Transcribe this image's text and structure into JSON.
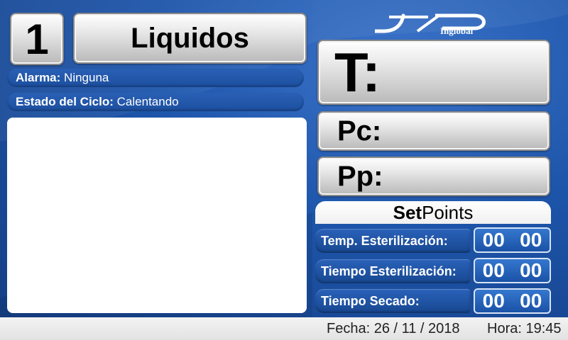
{
  "header": {
    "cycle_number": "1",
    "program_name": "Liquidos"
  },
  "status": {
    "alarm_label": "Alarma:",
    "alarm_value": "Ninguna",
    "cycle_state_label": "Estado del Ciclo:",
    "cycle_state_value": "Calentando"
  },
  "brand": {
    "name": "Inglobal"
  },
  "readings": {
    "t_label": "T:",
    "pc_label": "Pc:",
    "pp_label": "Pp:"
  },
  "setpoints": {
    "title_bold": "Set",
    "title_regular": "Points",
    "items": [
      {
        "label": "Temp. Esterilización:",
        "value_a": "00",
        "value_b": "00"
      },
      {
        "label": "Tiempo Esterilización:",
        "value_a": "00",
        "value_b": "00"
      },
      {
        "label": "Tiempo Secado:",
        "value_a": "00",
        "value_b": "00"
      }
    ]
  },
  "footer": {
    "date_text": "Fecha: 26  / 11 / 2018",
    "time_text": "Hora: 19:45"
  },
  "colors": {
    "background": "#1d55aa",
    "panel_blue": "#1c4f9f",
    "silver": "#d0d0d0"
  }
}
